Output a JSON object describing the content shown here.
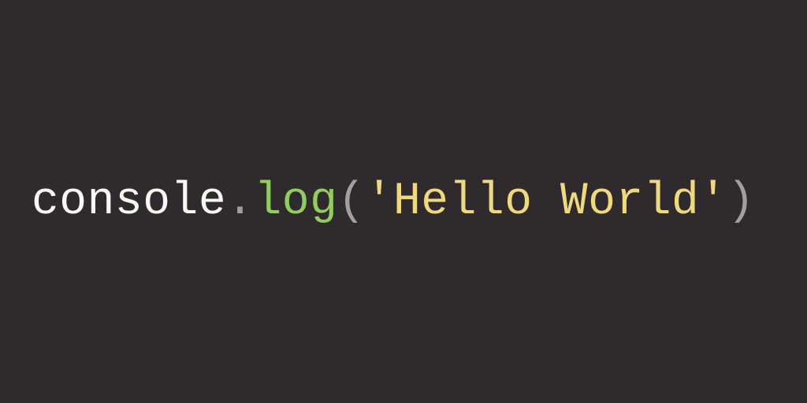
{
  "code": {
    "object": "console",
    "dot": ".",
    "method": "log",
    "openParen": "(",
    "string": "'Hello World'",
    "closeParen": ")"
  },
  "colors": {
    "background": "#2e2a2e",
    "default": "#f8f8f2",
    "punctuation": "#a0a0a0",
    "function": "#8fce5c",
    "string": "#f0d87d"
  }
}
